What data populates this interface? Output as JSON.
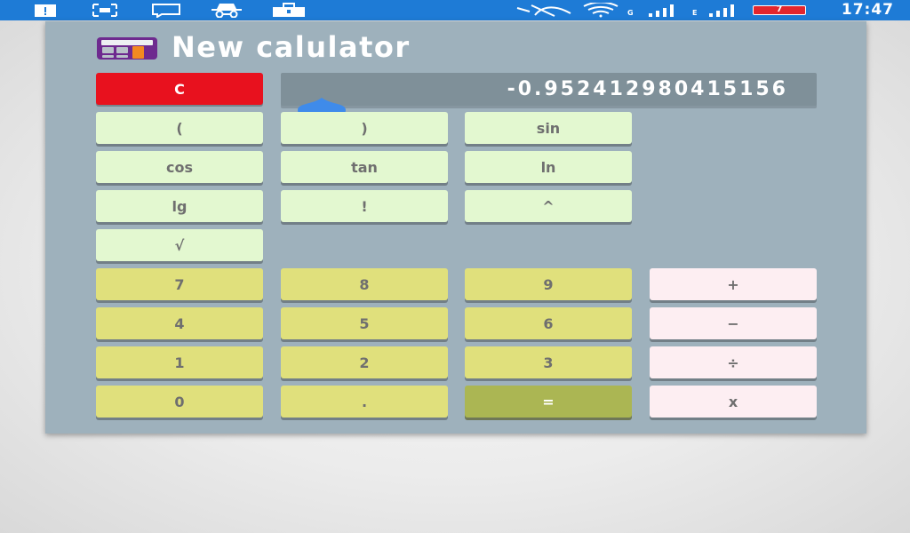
{
  "status_bar": {
    "time": "17:47",
    "battery_level": "7",
    "network_labels": [
      "G",
      "E"
    ],
    "background": "#1e7bd6",
    "icons": [
      "notification-icon",
      "screenshot-icon",
      "message-icon",
      "incognito-icon",
      "briefcase-icon",
      "data-off-icon",
      "wifi-icon",
      "signal-icon",
      "signal-icon",
      "battery-icon"
    ]
  },
  "app": {
    "title": "New calulator",
    "icon": "calculator-icon"
  },
  "display": {
    "value": "-0.952412980415156"
  },
  "buttons": {
    "clear": "C",
    "function_rows": [
      [
        "(",
        ")",
        "sin"
      ],
      [
        "cos",
        "tan",
        "ln"
      ],
      [
        "lg",
        "!",
        "^"
      ],
      [
        "√"
      ]
    ],
    "number_rows": [
      [
        "7",
        "8",
        "9"
      ],
      [
        "4",
        "5",
        "6"
      ],
      [
        "1",
        "2",
        "3"
      ],
      [
        "0",
        ".",
        "="
      ]
    ],
    "operators": [
      "+",
      "−",
      "÷",
      "x"
    ]
  },
  "colors": {
    "window_bg": "#9eb1bc",
    "display_bg": "#7f9099",
    "clear_button": "#e8111e",
    "function_button": "#e3f8d0",
    "number_button": "#e0e07c",
    "equals_button": "#abb653",
    "operator_button": "#fdeef2",
    "cursor_handle": "#3f8bea"
  }
}
